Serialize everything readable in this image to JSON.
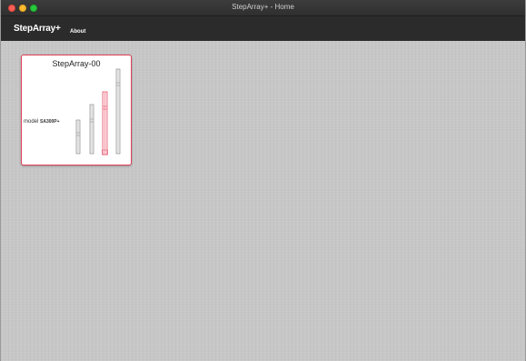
{
  "window": {
    "title": "StepArray+ - Home"
  },
  "navbar": {
    "brand": "StepArray+",
    "items": [
      {
        "label": "About"
      }
    ]
  },
  "cards": [
    {
      "title": "StepArray-00",
      "model_label": "model",
      "model_value": "SA300P+",
      "selected": true,
      "steppers": [
        {
          "id": 1,
          "highlighted": false
        },
        {
          "id": 2,
          "highlighted": false
        },
        {
          "id": 3,
          "highlighted": true
        },
        {
          "id": 4,
          "highlighted": false
        }
      ]
    }
  ],
  "colors": {
    "accent": "#e0405a",
    "navbar": "#2b2b2b",
    "background": "#c7c7c7"
  }
}
